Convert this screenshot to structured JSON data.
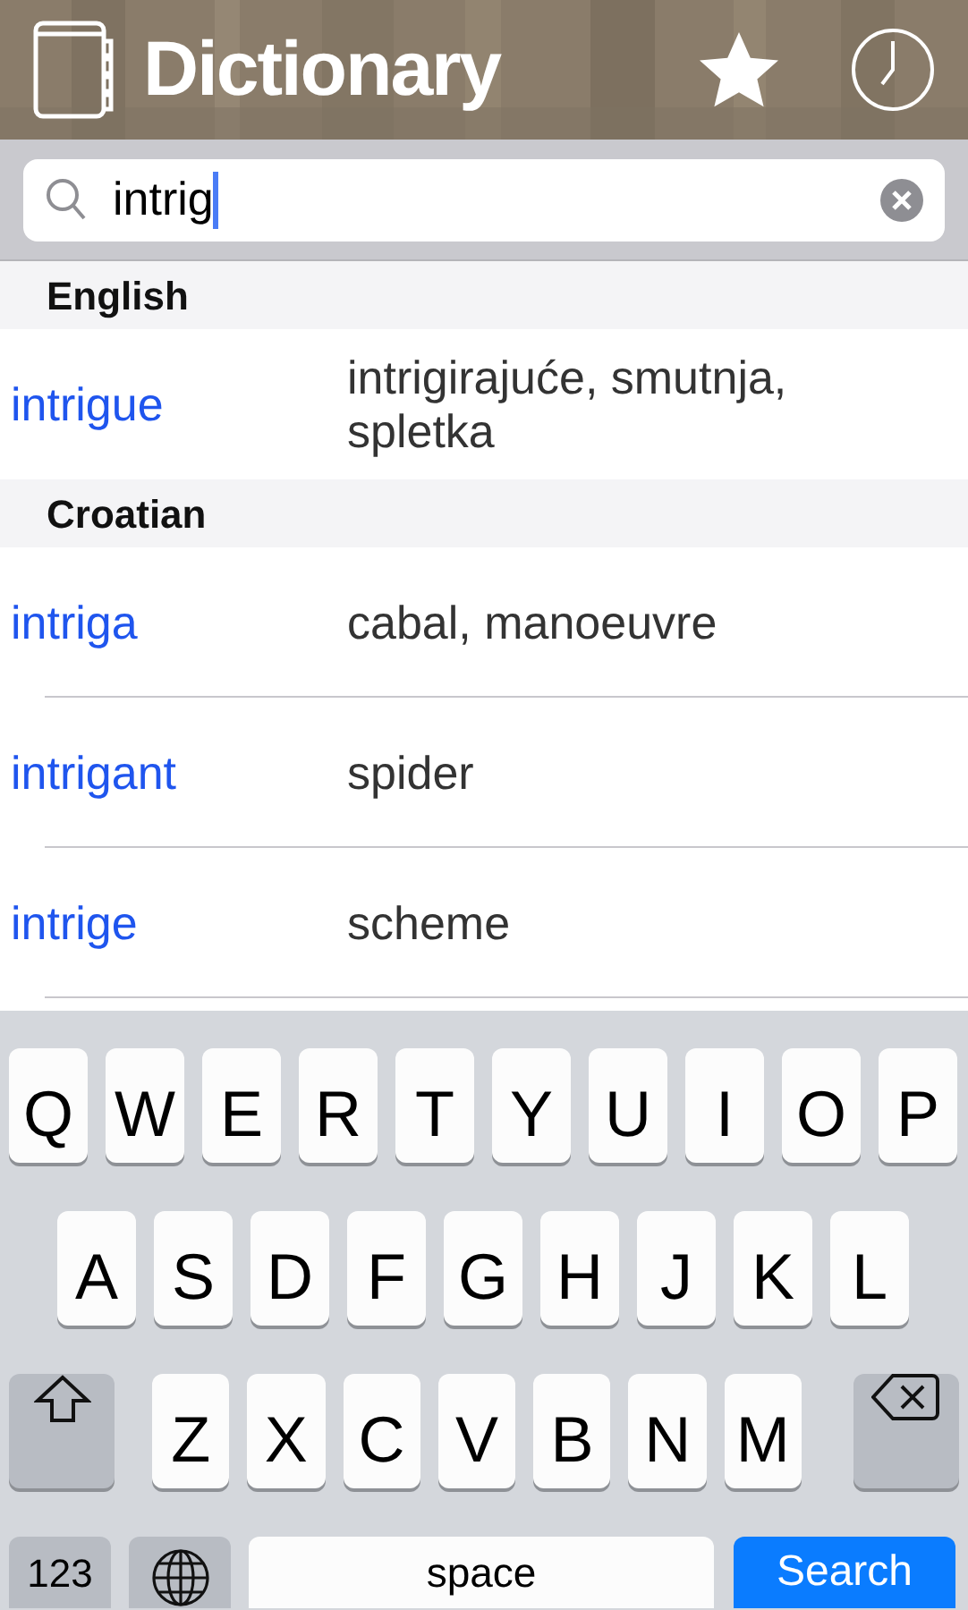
{
  "header": {
    "title": "Dictionary"
  },
  "search": {
    "value": "intrig"
  },
  "sections": [
    {
      "title": "English",
      "entries": [
        {
          "word": "intrigue",
          "translation": "intrigirajuće, smutnja, spletka"
        }
      ]
    },
    {
      "title": "Croatian",
      "entries": [
        {
          "word": "intriga",
          "translation": "cabal, manoeuvre"
        },
        {
          "word": "intrigant",
          "translation": "spider"
        },
        {
          "word": "intrige",
          "translation": "scheme"
        }
      ]
    }
  ],
  "keyboard": {
    "rows": [
      {
        "keys": [
          {
            "kind": "letter",
            "label": "Q"
          },
          {
            "kind": "letter",
            "label": "W"
          },
          {
            "kind": "letter",
            "label": "E"
          },
          {
            "kind": "letter",
            "label": "R"
          },
          {
            "kind": "letter",
            "label": "T"
          },
          {
            "kind": "letter",
            "label": "Y"
          },
          {
            "kind": "letter",
            "label": "U"
          },
          {
            "kind": "letter",
            "label": "I"
          },
          {
            "kind": "letter",
            "label": "O"
          },
          {
            "kind": "letter",
            "label": "P"
          }
        ]
      },
      {
        "keys": [
          {
            "kind": "letter",
            "label": "A"
          },
          {
            "kind": "letter",
            "label": "S"
          },
          {
            "kind": "letter",
            "label": "D"
          },
          {
            "kind": "letter",
            "label": "F"
          },
          {
            "kind": "letter",
            "label": "G"
          },
          {
            "kind": "letter",
            "label": "H"
          },
          {
            "kind": "letter",
            "label": "J"
          },
          {
            "kind": "letter",
            "label": "K"
          },
          {
            "kind": "letter",
            "label": "L"
          }
        ]
      },
      {
        "keys": [
          {
            "kind": "shift"
          },
          {
            "kind": "letter",
            "label": "Z"
          },
          {
            "kind": "letter",
            "label": "X"
          },
          {
            "kind": "letter",
            "label": "C"
          },
          {
            "kind": "letter",
            "label": "V"
          },
          {
            "kind": "letter",
            "label": "B"
          },
          {
            "kind": "letter",
            "label": "N"
          },
          {
            "kind": "letter",
            "label": "M"
          },
          {
            "kind": "delete"
          }
        ]
      },
      {
        "keys": [
          {
            "kind": "mode",
            "label": "123"
          },
          {
            "kind": "globe"
          },
          {
            "kind": "space",
            "label": "space"
          },
          {
            "kind": "action",
            "label": "Search"
          }
        ]
      }
    ]
  }
}
